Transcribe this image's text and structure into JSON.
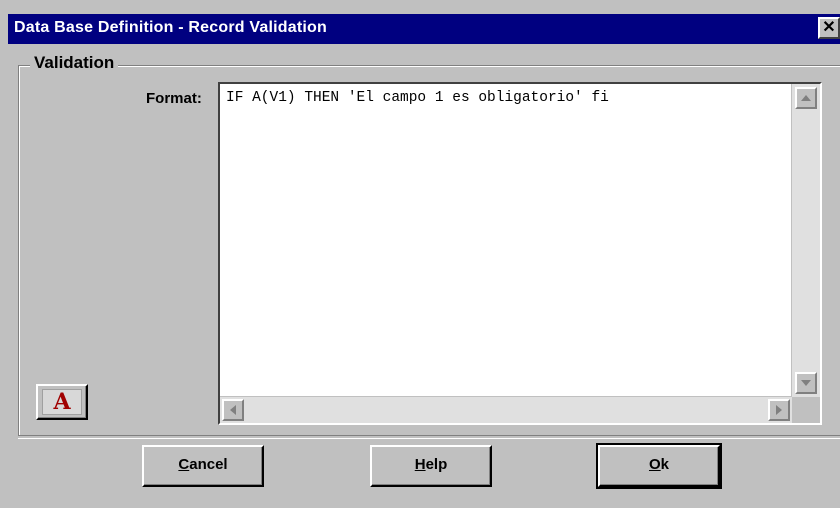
{
  "window": {
    "title": "Data Base Definition - Record Validation",
    "close_glyph": "✕"
  },
  "validation": {
    "group_label": "Validation",
    "format_label": "Format:",
    "format_value": "IF A(V1) THEN 'El campo 1 es obligatorio' fi"
  },
  "font_button": {
    "label": "A",
    "color": "#a00000"
  },
  "buttons": {
    "cancel": {
      "mnemonic": "C",
      "rest": "ancel"
    },
    "help": {
      "mnemonic": "H",
      "rest": "elp"
    },
    "ok": {
      "mnemonic": "O",
      "rest": "k"
    }
  },
  "colors": {
    "titlebar": "#000080",
    "face": "#c0c0c0"
  }
}
